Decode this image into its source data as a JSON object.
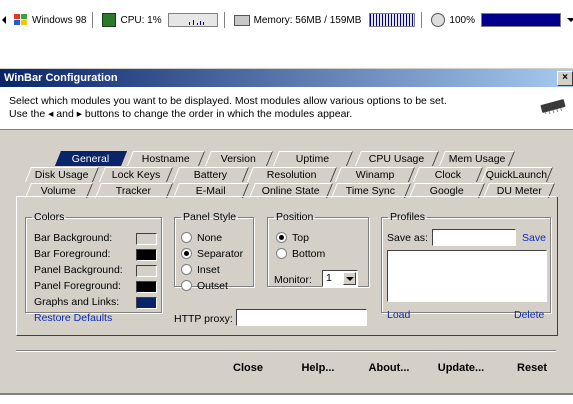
{
  "winbar": {
    "os_label": "Windows 98",
    "cpu_label": "CPU: 1%",
    "memory_label": "Memory: 56MB / 159MB",
    "volume_label": "100%",
    "icons": [
      "scroll-left-arrow-icon",
      "windows-flag-icon",
      "cpu-chip-icon",
      "memory-stick-icon",
      "volume-speaker-icon",
      "dropdown-arrow-icon"
    ]
  },
  "dialog": {
    "title": "WinBar Configuration",
    "close_glyph": "×",
    "description": "Select which modules you want to be displayed. Most modules allow various options to be set. Use the ◂ and ▸ buttons to change the order in which the modules appear.",
    "tabs_row1": [
      "General",
      "Hostname",
      "Version",
      "Uptime",
      "CPU Usage",
      "Mem Usage"
    ],
    "tabs_row2": [
      "Disk Usage",
      "Lock Keys",
      "Battery",
      "Resolution",
      "Winamp",
      "Clock",
      "QuickLaunch"
    ],
    "tabs_row3": [
      "Volume",
      "Tracker",
      "E-Mail",
      "Online State",
      "Time Sync",
      "Google",
      "DU Meter"
    ],
    "active_tab": "General",
    "colors": {
      "legend": "Colors",
      "bar_background_label": "Bar Background:",
      "bar_foreground_label": "Bar Foreground:",
      "panel_background_label": "Panel Background:",
      "panel_foreground_label": "Panel Foreground:",
      "graphs_links_label": "Graphs and Links:",
      "swatches": {
        "bar_background": "#d4d0c8",
        "bar_foreground": "#000000",
        "panel_background": "#d4d0c8",
        "panel_foreground": "#000000",
        "graphs_links": "#0a246a"
      },
      "restore_defaults": "Restore Defaults"
    },
    "panel_style": {
      "legend": "Panel Style",
      "options": [
        "None",
        "Separator",
        "Inset",
        "Outset"
      ],
      "selected": "Separator"
    },
    "position": {
      "legend": "Position",
      "options": [
        "Top",
        "Bottom"
      ],
      "selected": "Top",
      "monitor_label": "Monitor:",
      "monitor_value": "1"
    },
    "http_proxy": {
      "label": "HTTP proxy:",
      "value": ""
    },
    "profiles": {
      "legend": "Profiles",
      "save_as_label": "Save as:",
      "save_as_value": "",
      "save_link": "Save",
      "load_link": "Load",
      "delete_link": "Delete"
    },
    "buttons": [
      "Close",
      "Help...",
      "About...",
      "Update...",
      "Reset"
    ]
  }
}
